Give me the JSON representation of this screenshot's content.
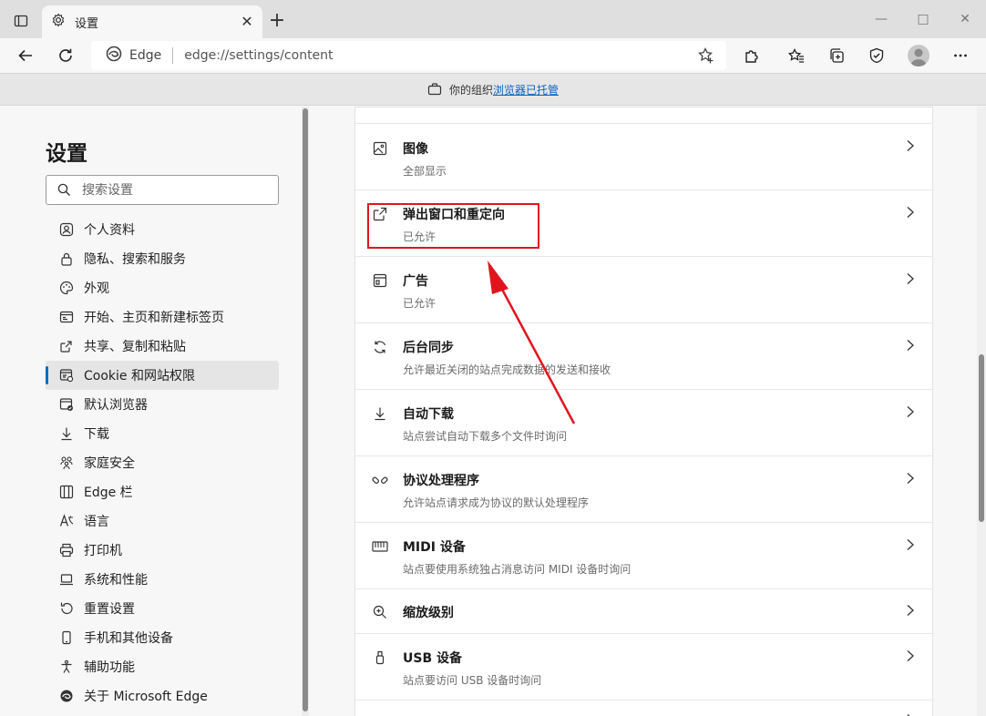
{
  "tab": {
    "title": "设置",
    "close": "✕",
    "new_tab": "+"
  },
  "window": {
    "minimize": "—",
    "restore": "□",
    "close": "✕"
  },
  "address": {
    "site_label": "Edge",
    "url": "edge://settings/content"
  },
  "banner": {
    "prefix": "你的组织",
    "link": "浏览器已托管"
  },
  "sidebar": {
    "title": "设置",
    "search_placeholder": "搜索设置",
    "items": [
      {
        "label": "个人资料",
        "icon": "profile-icon"
      },
      {
        "label": "隐私、搜索和服务",
        "icon": "lock-icon"
      },
      {
        "label": "外观",
        "icon": "palette-icon"
      },
      {
        "label": "开始、主页和新建标签页",
        "icon": "newtab-icon"
      },
      {
        "label": "共享、复制和粘贴",
        "icon": "share-icon"
      },
      {
        "label": "Cookie 和网站权限",
        "icon": "site-permissions-icon",
        "active": true
      },
      {
        "label": "默认浏览器",
        "icon": "default-browser-icon"
      },
      {
        "label": "下载",
        "icon": "download-icon"
      },
      {
        "label": "家庭安全",
        "icon": "family-icon"
      },
      {
        "label": "Edge 栏",
        "icon": "edge-bar-icon"
      },
      {
        "label": "语言",
        "icon": "language-icon"
      },
      {
        "label": "打印机",
        "icon": "printer-icon"
      },
      {
        "label": "系统和性能",
        "icon": "laptop-icon"
      },
      {
        "label": "重置设置",
        "icon": "reset-icon"
      },
      {
        "label": "手机和其他设备",
        "icon": "phone-icon"
      },
      {
        "label": "辅助功能",
        "icon": "accessibility-icon"
      },
      {
        "label": "关于 Microsoft Edge",
        "icon": "edge-logo-icon"
      }
    ]
  },
  "content": {
    "rows": [
      {
        "title": "图像",
        "subtitle": "全部显示",
        "icon": "image-icon"
      },
      {
        "title": "弹出窗口和重定向",
        "subtitle": "已允许",
        "icon": "popup-icon"
      },
      {
        "title": "广告",
        "subtitle": "已允许",
        "icon": "ads-icon"
      },
      {
        "title": "后台同步",
        "subtitle": "允许最近关闭的站点完成数据的发送和接收",
        "icon": "sync-icon"
      },
      {
        "title": "自动下载",
        "subtitle": "站点尝试自动下载多个文件时询问",
        "icon": "download-icon"
      },
      {
        "title": "协议处理程序",
        "subtitle": "允许站点请求成为协议的默认处理程序",
        "icon": "protocol-icon"
      },
      {
        "title": "MIDI 设备",
        "subtitle": "站点要使用系统独占消息访问 MIDI 设备时询问",
        "icon": "midi-icon"
      },
      {
        "title": "缩放级别",
        "subtitle": "",
        "icon": "zoom-icon"
      },
      {
        "title": "USB 设备",
        "subtitle": "站点要访问 USB 设备时询问",
        "icon": "usb-icon"
      }
    ]
  },
  "colors": {
    "annotation": "#e1141d",
    "accent": "#0f6cbd",
    "link": "#0b63c4"
  }
}
